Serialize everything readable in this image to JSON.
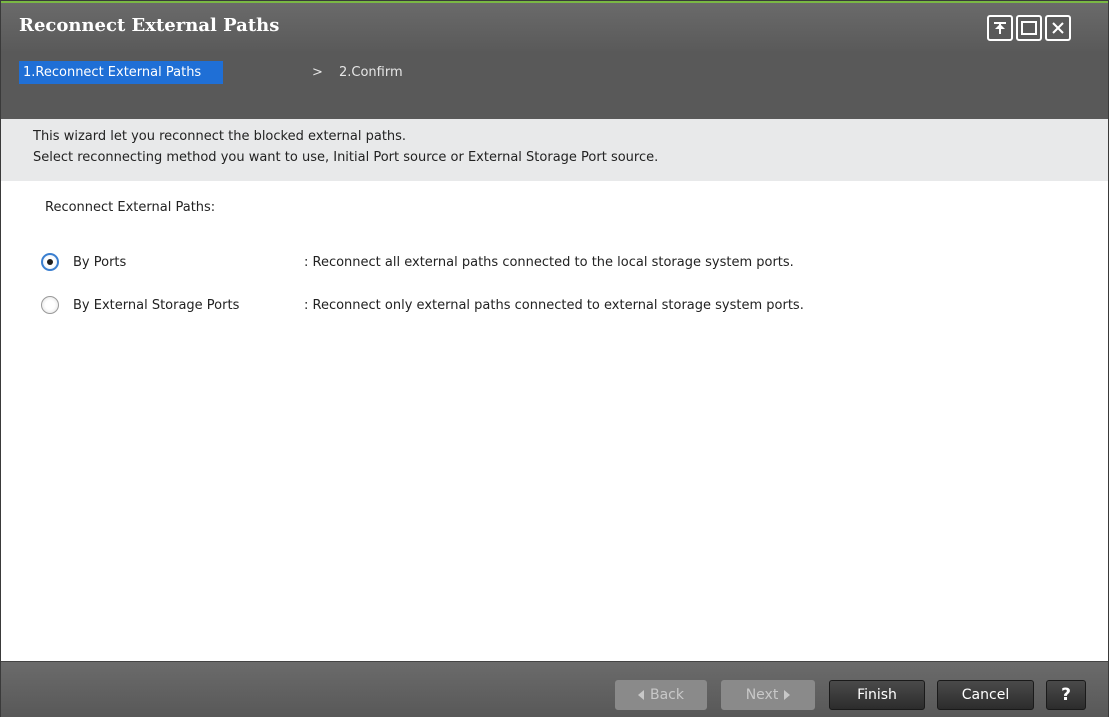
{
  "window": {
    "title": "Reconnect External Paths",
    "controls": [
      "pin-icon",
      "maximize-icon",
      "close-icon"
    ]
  },
  "steps": {
    "active": "1.Reconnect External Paths",
    "separator": ">",
    "next": "2.Confirm"
  },
  "description": {
    "line1": "This wizard let you reconnect the blocked external paths.",
    "line2": "Select reconnecting method you want to use, Initial Port source or External Storage Port source."
  },
  "form": {
    "section_label": "Reconnect External Paths:",
    "options": [
      {
        "label": "By Ports",
        "description": ": Reconnect all external paths connected to the local storage system ports.",
        "selected": true
      },
      {
        "label": "By External Storage Ports",
        "description": ": Reconnect only external paths connected to external storage system ports.",
        "selected": false
      }
    ]
  },
  "footer": {
    "back_label": "Back",
    "next_label": "Next",
    "finish_label": "Finish",
    "cancel_label": "Cancel",
    "help_label": "?"
  },
  "colors": {
    "accent": "#1f6fd6",
    "titlebar": "#5a5a5a",
    "title_border": "#7ab844"
  }
}
